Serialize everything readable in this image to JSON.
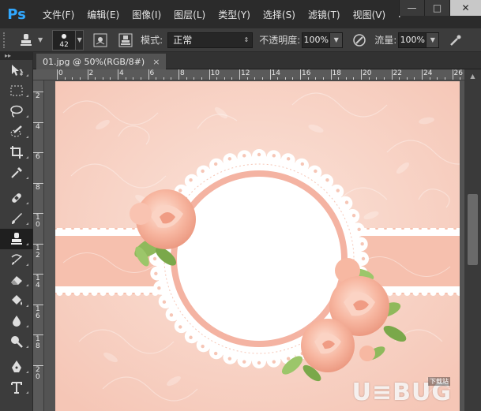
{
  "app": {
    "logo": "Ps"
  },
  "menu": {
    "items": [
      "文件(F)",
      "编辑(E)",
      "图像(I)",
      "图层(L)",
      "类型(Y)",
      "选择(S)",
      "滤镜(T)",
      "视图(V)",
      "i"
    ]
  },
  "window_controls": {
    "minimize": "—",
    "restore": "□",
    "close": "✕"
  },
  "options": {
    "brush_size": "42",
    "mode_label": "模式:",
    "mode_value": "正常",
    "opacity_label": "不透明度:",
    "opacity_value": "100%",
    "flow_label": "流量:",
    "flow_value": "100%"
  },
  "document": {
    "tab_title": "01.jpg @ 50%(RGB/8#)",
    "tab_close": "×"
  },
  "rulers": {
    "top": [
      "0",
      "2",
      "4",
      "6",
      "8",
      "10",
      "12",
      "14",
      "16",
      "18",
      "20",
      "22",
      "24",
      "26"
    ],
    "left": [
      "2",
      "4",
      "6",
      "8",
      "1\n0",
      "1\n2",
      "1\n4",
      "1\n6",
      "1\n8",
      "2\n0"
    ]
  },
  "watermark": {
    "text": "U≡BUG",
    "small": "下载站"
  },
  "colors": {
    "accent": "#31a8ff",
    "canvas_pink": "#f7cfc1",
    "frame_pink": "#f4b3a2"
  }
}
